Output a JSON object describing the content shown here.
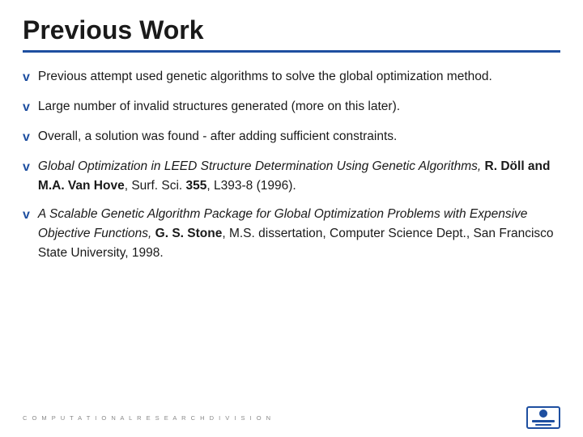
{
  "slide": {
    "title": "Previous Work",
    "divider_color": "#1e4fa0",
    "bullets": [
      {
        "id": 1,
        "text_parts": [
          {
            "text": "Previous attempt used genetic algorithms to solve the global optimization method.",
            "style": "normal"
          }
        ]
      },
      {
        "id": 2,
        "text_parts": [
          {
            "text": "Large number of invalid structures generated (more on this later).",
            "style": "normal"
          }
        ]
      },
      {
        "id": 3,
        "text_parts": [
          {
            "text": "Overall, a solution was found - after adding sufficient constraints.",
            "style": "normal"
          }
        ]
      },
      {
        "id": 4,
        "text_parts": [
          {
            "text": "Global Optimization in LEED Structure Determination Using Genetic Algorithms, ",
            "style": "italic"
          },
          {
            "text": "R. Döll and M.A. Van Hove",
            "style": "bold"
          },
          {
            "text": ", Surf. Sci. ",
            "style": "normal"
          },
          {
            "text": "355",
            "style": "bold"
          },
          {
            "text": ", L393-8 (1996).",
            "style": "normal"
          }
        ]
      },
      {
        "id": 5,
        "text_parts": [
          {
            "text": "A Scalable Genetic Algorithm Package for Global Optimization Problems with Expensive Objective Functions, ",
            "style": "italic"
          },
          {
            "text": "G. S. Stone",
            "style": "bold"
          },
          {
            "text": ", M.S. dissertation, Computer Science Dept., San Francisco State University, 1998.",
            "style": "normal"
          }
        ]
      }
    ],
    "footer": {
      "text": "C O M P U T A T I O N A L   R E S E A R C H   D I V I S I O N"
    }
  }
}
